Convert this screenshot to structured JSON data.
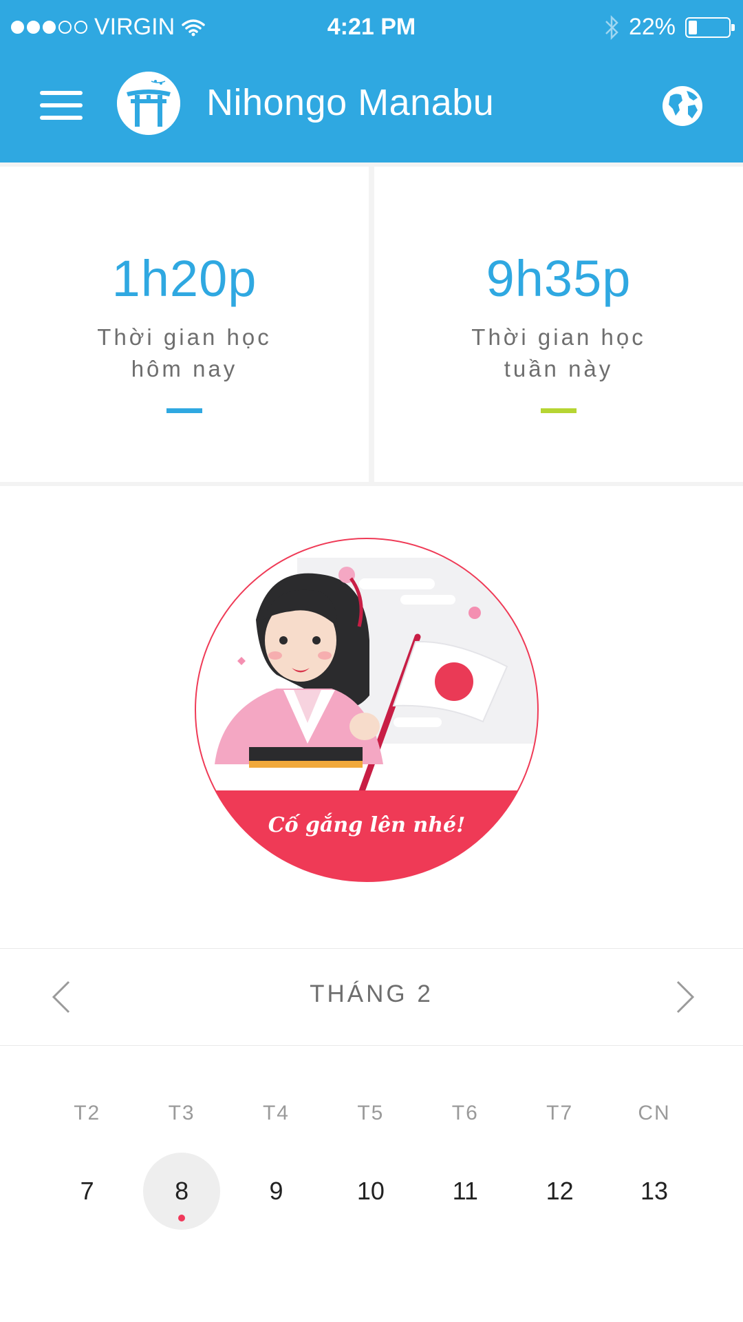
{
  "status_bar": {
    "carrier": "VIRGIN",
    "time": "4:21 PM",
    "battery": "22%",
    "battery_level": 0.22,
    "signal_bars": 3,
    "signal_total": 5
  },
  "header": {
    "title": "Nihongo Manabu",
    "icons": [
      "menu-icon",
      "torii-logo",
      "globe-icon"
    ],
    "bg_color": "#2fa8e1"
  },
  "stats": [
    {
      "value": "1h20p",
      "label_line1": "Thời gian học",
      "label_line2": "hôm nay",
      "accent": "#2fa8e1"
    },
    {
      "value": "9h35p",
      "label_line1": "Thời gian học",
      "label_line2": "tuần này",
      "accent": "#b6d533"
    }
  ],
  "hero": {
    "banner_text": "Cố gắng lên nhé!",
    "banner_color": "#ef3a56"
  },
  "calendar": {
    "month_label": "THÁNG 2",
    "weekdays": [
      "T2",
      "T3",
      "T4",
      "T5",
      "T6",
      "T7",
      "CN"
    ],
    "days": [
      "7",
      "8",
      "9",
      "10",
      "11",
      "12",
      "13"
    ],
    "selected_day": "8"
  }
}
